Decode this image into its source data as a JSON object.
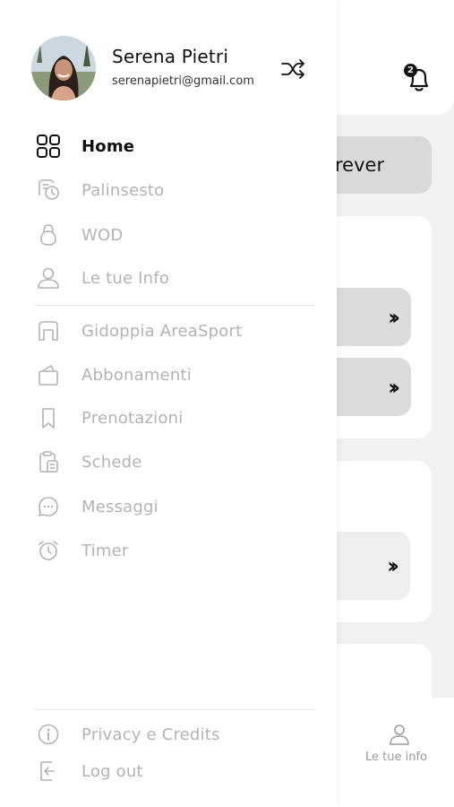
{
  "user": {
    "name": "Serena Pietri",
    "email": "serenapietri@gmail.com"
  },
  "menu": {
    "items": [
      {
        "label": "Home",
        "icon": "grid-icon",
        "active": true
      },
      {
        "label": "Palinsesto",
        "icon": "history-icon",
        "active": false
      },
      {
        "label": "WOD",
        "icon": "kettlebell-icon",
        "active": false
      },
      {
        "label": "Le tue Info",
        "icon": "user-icon",
        "active": false
      }
    ],
    "section_items": [
      {
        "label": "Gidoppia AreaSport",
        "icon": "gym-icon"
      },
      {
        "label": "Abbonamenti",
        "icon": "wallet-icon"
      },
      {
        "label": "Prenotazioni",
        "icon": "bookmark-icon"
      },
      {
        "label": "Schede",
        "icon": "clipboard-icon"
      },
      {
        "label": "Messaggi",
        "icon": "chat-icon"
      },
      {
        "label": "Timer",
        "icon": "alarm-icon"
      }
    ],
    "footer_items": [
      {
        "label": "Privacy e Credits",
        "icon": "info-icon"
      },
      {
        "label": "Log out",
        "icon": "logout-icon"
      }
    ]
  },
  "background": {
    "notification_count": "2",
    "pill_text": "rever",
    "tabbar_label": "Le tue info"
  },
  "colors": {
    "active_text": "#111111",
    "inactive_text": "#b3b3b3",
    "drawer_bg": "#ffffff",
    "page_bg": "#f1f1f2"
  }
}
